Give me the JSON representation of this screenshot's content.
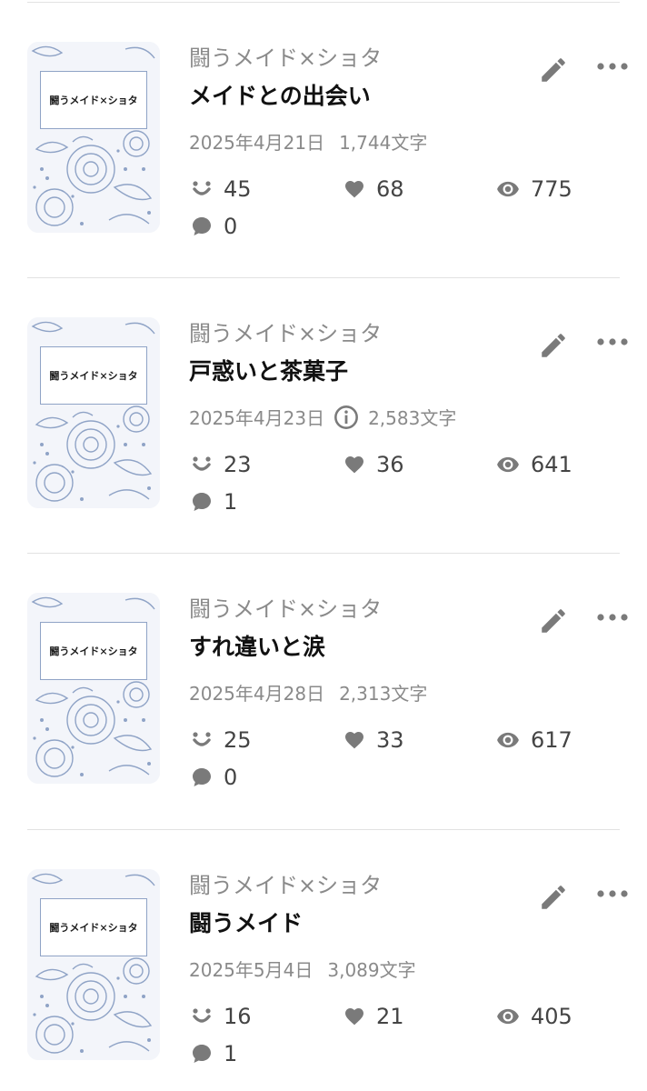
{
  "items": [
    {
      "cover_text": "闘うメイド×ショタ",
      "series": "闘うメイド×ショタ",
      "title": "メイドとの出会い",
      "date": "2025年4月21日",
      "chars": "1,744文字",
      "has_info_icon": false,
      "reactions": "45",
      "likes": "68",
      "views": "775",
      "comments": "0"
    },
    {
      "cover_text": "闘うメイド×ショタ",
      "series": "闘うメイド×ショタ",
      "title": "戸惑いと茶菓子",
      "date": "2025年4月23日",
      "chars": "2,583文字",
      "has_info_icon": true,
      "reactions": "23",
      "likes": "36",
      "views": "641",
      "comments": "1"
    },
    {
      "cover_text": "闘うメイド×ショタ",
      "series": "闘うメイド×ショタ",
      "title": "すれ違いと涙",
      "date": "2025年4月28日",
      "chars": "2,313文字",
      "has_info_icon": false,
      "reactions": "25",
      "likes": "33",
      "views": "617",
      "comments": "0"
    },
    {
      "cover_text": "闘うメイド×ショタ",
      "series": "闘うメイド×ショタ",
      "title": "闘うメイド",
      "date": "2025年5月4日",
      "chars": "3,089文字",
      "has_info_icon": false,
      "reactions": "16",
      "likes": "21",
      "views": "405",
      "comments": "1"
    }
  ],
  "icons": {
    "reaction": "reaction-icon",
    "like": "heart-icon",
    "view": "eye-icon",
    "comment": "comment-icon",
    "edit": "pencil-icon",
    "more": "more-icon",
    "info": "info-icon"
  },
  "colors": {
    "icon_gray": "#7a7a7a",
    "cover_blue": "#8fa3c6"
  }
}
